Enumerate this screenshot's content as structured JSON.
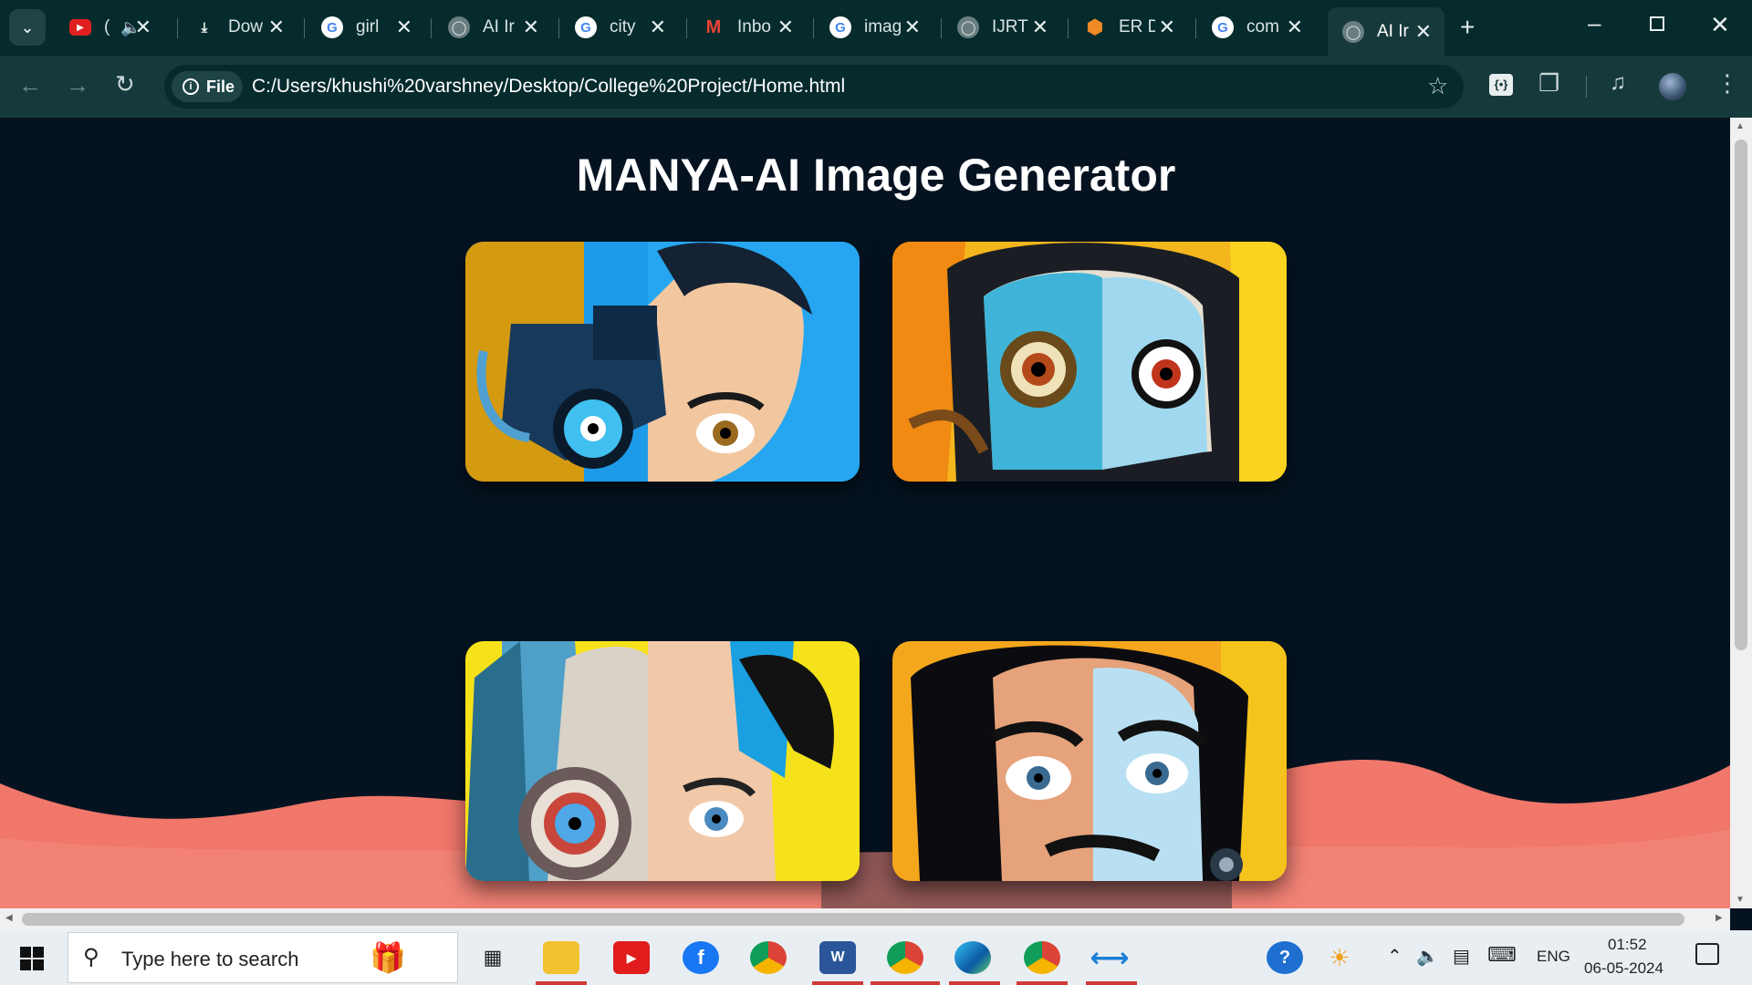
{
  "browser": {
    "tabs": [
      {
        "title": "(",
        "favicon": "youtube-icon",
        "audio": true
      },
      {
        "title": "Dow",
        "favicon": "download-icon"
      },
      {
        "title": "girl",
        "favicon": "google-icon"
      },
      {
        "title": "AI Ir",
        "favicon": "globe-icon"
      },
      {
        "title": "city",
        "favicon": "google-icon"
      },
      {
        "title": "Inbo",
        "favicon": "gmail-icon"
      },
      {
        "title": "imag",
        "favicon": "google-icon"
      },
      {
        "title": "IJRTI",
        "favicon": "globe-icon"
      },
      {
        "title": "ER D",
        "favicon": "hexagon-icon"
      },
      {
        "title": "com",
        "favicon": "google-icon"
      },
      {
        "title": "AI Ir",
        "favicon": "globe-icon",
        "active": true
      }
    ],
    "file_chip": "File",
    "url": "C:/Users/khushi%20varshney/Desktop/College%20Project/Home.html"
  },
  "page": {
    "title": "MANYA-AI Image Generator",
    "images": [
      {
        "name": "surreal-portrait-1"
      },
      {
        "name": "surreal-portrait-2"
      },
      {
        "name": "surreal-portrait-3"
      },
      {
        "name": "surreal-portrait-4"
      }
    ],
    "colors": {
      "background": "#051321",
      "wave": "#f0776a",
      "title": "#ffffff"
    }
  },
  "taskbar": {
    "search_placeholder": "Type here to search",
    "language": "ENG",
    "time": "01:52",
    "date": "06-05-2024"
  }
}
